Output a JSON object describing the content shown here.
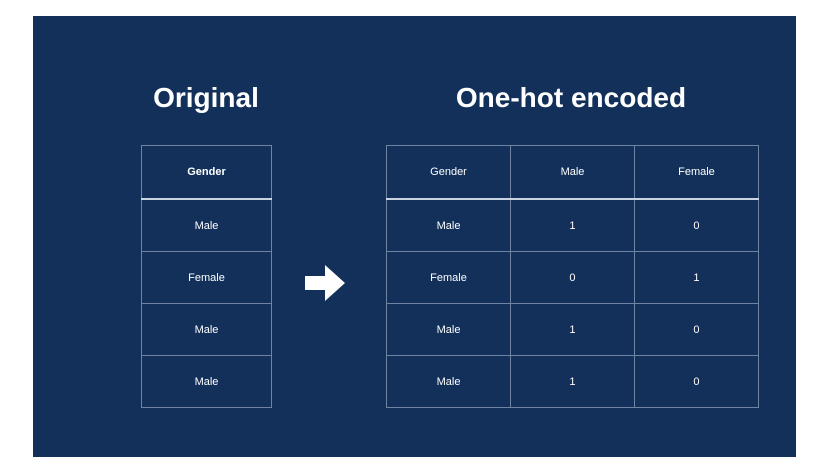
{
  "original": {
    "title": "Original",
    "header": "Gender",
    "rows": [
      "Male",
      "Female",
      "Male",
      "Male"
    ]
  },
  "encoded": {
    "title": "One-hot encoded",
    "headers": [
      "Gender",
      "Male",
      "Female"
    ],
    "rows": [
      [
        "Male",
        "1",
        "0"
      ],
      [
        "Female",
        "0",
        "1"
      ],
      [
        "Male",
        "1",
        "0"
      ],
      [
        "Male",
        "1",
        "0"
      ]
    ]
  },
  "arrow_icon": "right-arrow-icon",
  "colors": {
    "background": "#12305a",
    "text": "#ffffff",
    "grid": "#6f84a3"
  }
}
